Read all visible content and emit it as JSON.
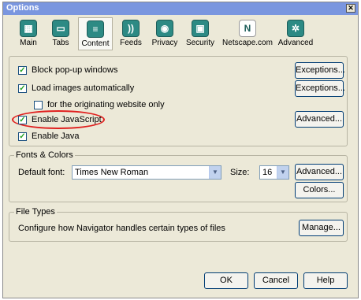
{
  "window": {
    "title": "Options",
    "close": "✕"
  },
  "toolbar": {
    "items": [
      {
        "label": "Main",
        "icon": "grid-icon"
      },
      {
        "label": "Tabs",
        "icon": "tabs-icon"
      },
      {
        "label": "Content",
        "icon": "content-icon"
      },
      {
        "label": "Feeds",
        "icon": "feed-icon"
      },
      {
        "label": "Privacy",
        "icon": "eye-icon"
      },
      {
        "label": "Security",
        "icon": "lock-icon"
      },
      {
        "label": "Netscape.com",
        "icon": "netscape-icon"
      },
      {
        "label": "Advanced",
        "icon": "gear-icon"
      }
    ],
    "netscape_glyph": "N"
  },
  "content": {
    "block_popups": "Block pop-up windows",
    "load_images": "Load images automatically",
    "originating_site": "for the originating website only",
    "enable_js": "Enable JavaScript",
    "enable_java": "Enable Java",
    "exceptions1": "Exceptions...",
    "exceptions2": "Exceptions...",
    "advanced_js": "Advanced..."
  },
  "fonts": {
    "title": "Fonts & Colors",
    "default_font_label": "Default font:",
    "default_font_value": "Times New Roman",
    "size_label": "Size:",
    "size_value": "16",
    "advanced": "Advanced...",
    "colors": "Colors..."
  },
  "filetypes": {
    "title": "File Types",
    "description": "Configure how Navigator handles certain types of files",
    "manage": "Manage..."
  },
  "footer": {
    "ok": "OK",
    "cancel": "Cancel",
    "help": "Help"
  },
  "check": "✓",
  "arrow": "▼",
  "colors": {
    "accent": "#7a96df",
    "highlight": "#e0201f",
    "icon_bg": "#2d8a84"
  }
}
